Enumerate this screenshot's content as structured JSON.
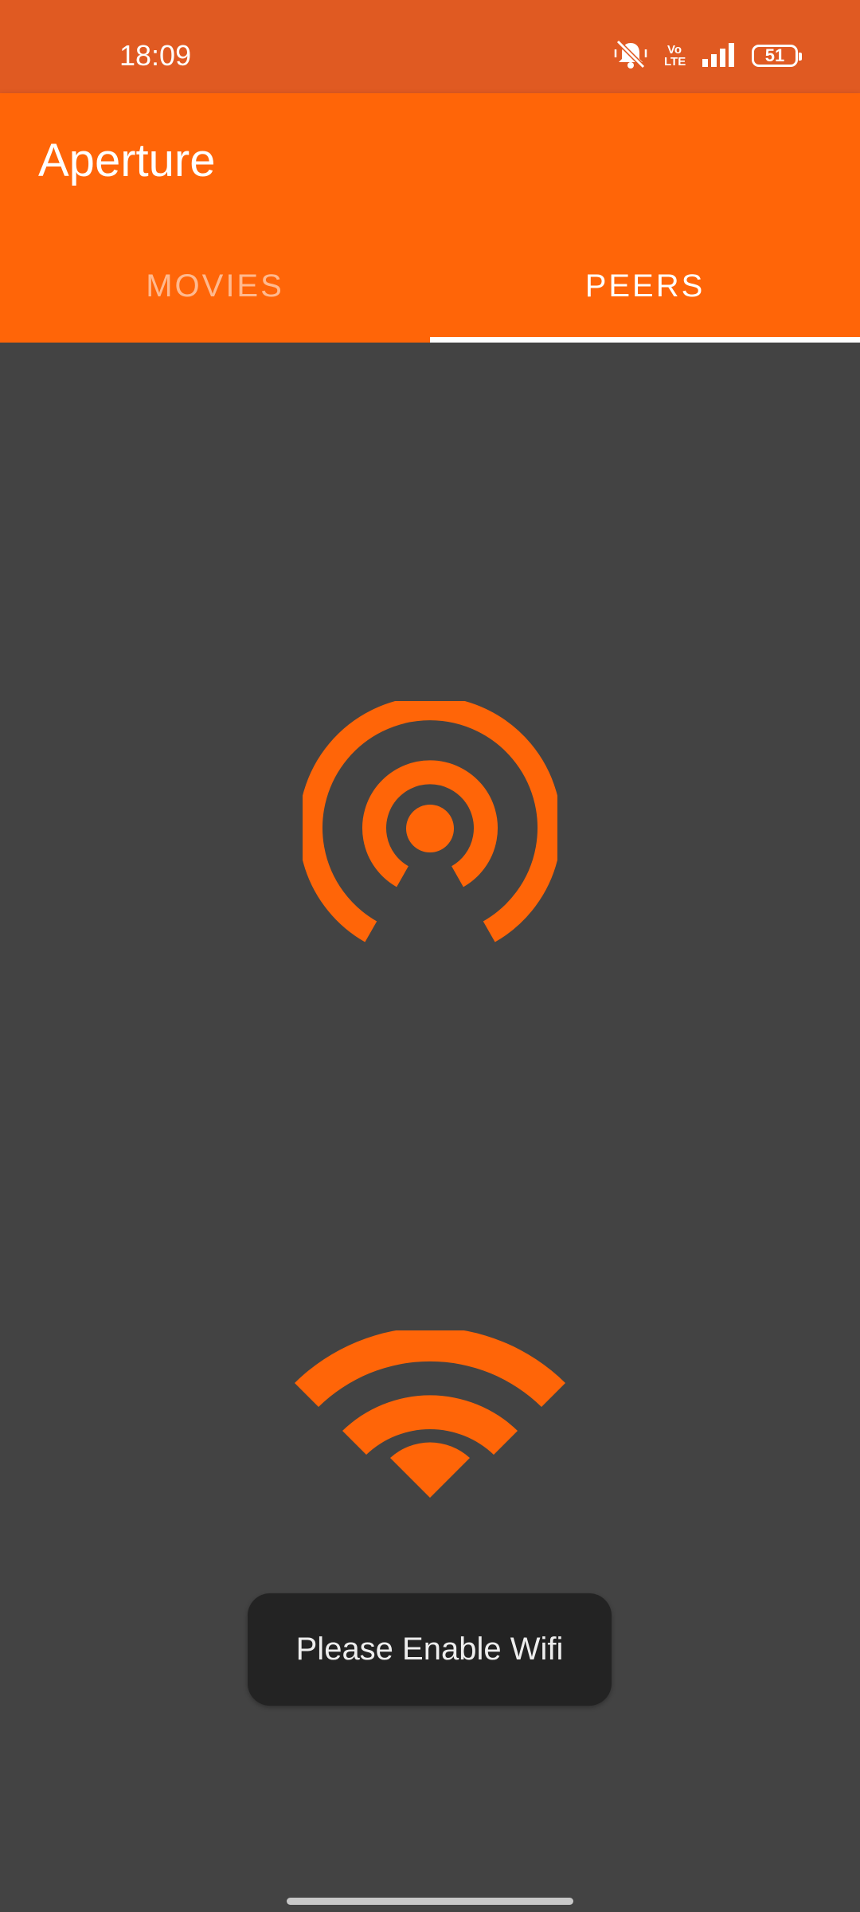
{
  "status_bar": {
    "time": "18:09",
    "volte_line1": "Vo",
    "volte_line2": "LTE",
    "battery": "51",
    "icons": [
      "muted-bell-icon",
      "volte-icon",
      "signal-icon",
      "battery-icon"
    ]
  },
  "app_bar": {
    "title": "Aperture"
  },
  "tabs": [
    {
      "label": "MOVIES",
      "selected": false
    },
    {
      "label": "PEERS",
      "selected": true
    }
  ],
  "content": {
    "icons": [
      "hotspot-icon",
      "wifi-icon"
    ]
  },
  "toast": {
    "message": "Please Enable Wifi"
  },
  "colors": {
    "status_bar": "#E05A22",
    "app_bar": "#FF6508",
    "accent": "#FF6508",
    "background": "#434343",
    "toast": "#232323"
  }
}
